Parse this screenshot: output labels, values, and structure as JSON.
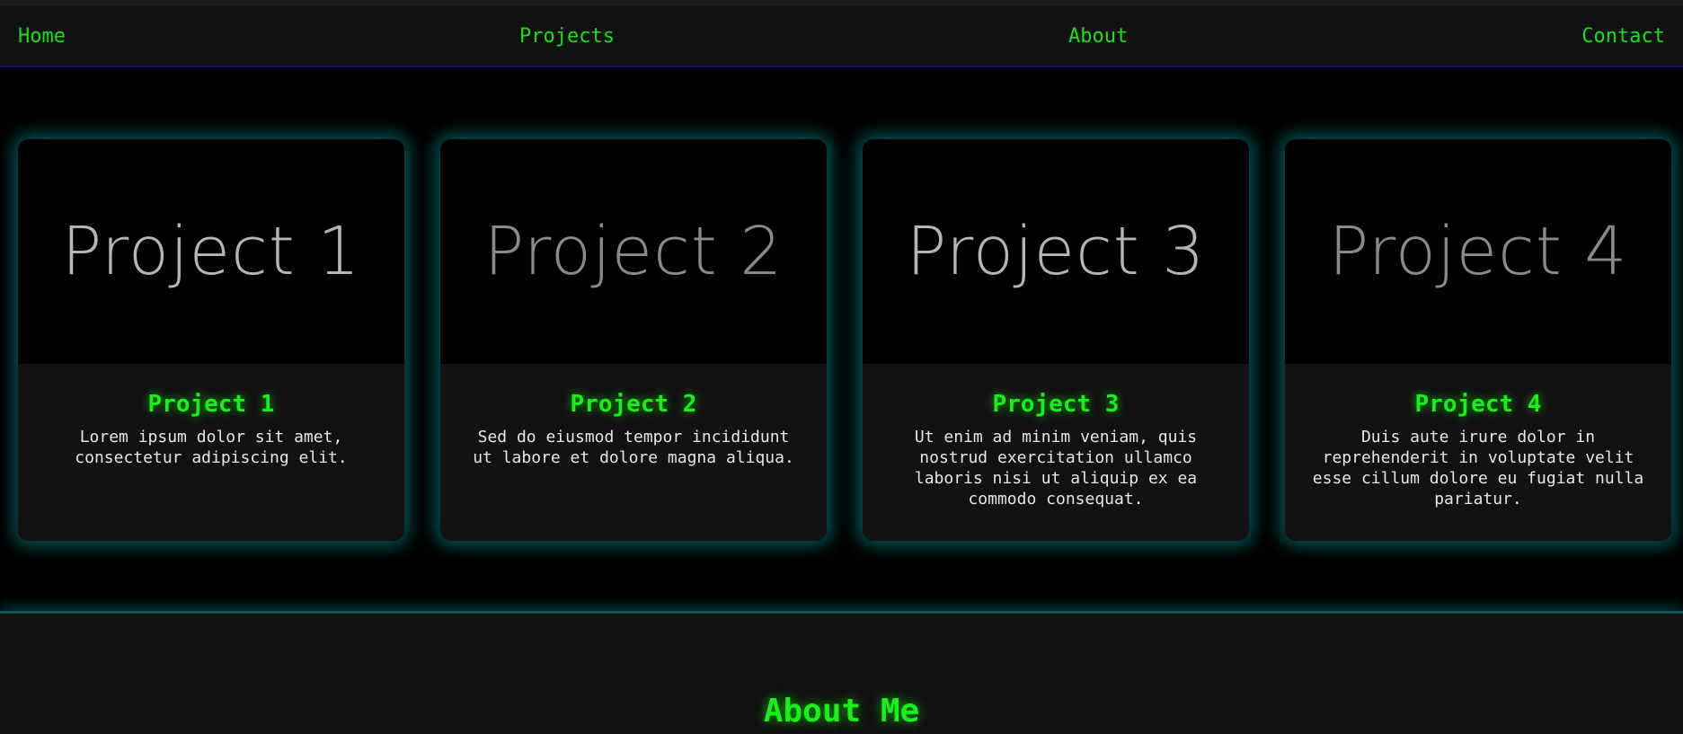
{
  "nav": {
    "items": [
      {
        "label": "Home"
      },
      {
        "label": "Projects"
      },
      {
        "label": "About"
      },
      {
        "label": "Contact"
      }
    ]
  },
  "projects": [
    {
      "image_text": "Project 1",
      "image_text_color": "#b5b5b5",
      "title": "Project 1",
      "description": "Lorem ipsum dolor sit amet, consectetur adipiscing elit."
    },
    {
      "image_text": "Project 2",
      "image_text_color": "#8a8a8a",
      "title": "Project 2",
      "description": "Sed do eiusmod tempor incididunt ut labore et dolore magna aliqua."
    },
    {
      "image_text": "Project 3",
      "image_text_color": "#b5b5b5",
      "title": "Project 3",
      "description": "Ut enim ad minim veniam, quis nostrud exercitation ullamco laboris nisi ut aliquip ex ea commodo consequat."
    },
    {
      "image_text": "Project 4",
      "image_text_color": "#8a8a8a",
      "title": "Project 4",
      "description": "Duis aute irure dolor in reprehenderit in voluptate velit esse cillum dolore eu fugiat nulla pariatur."
    }
  ],
  "about": {
    "title": "About Me"
  },
  "colors": {
    "accent": "#18f018",
    "glow": "#009696",
    "nav_border": "#0a0a8a",
    "background": "#000000",
    "surface": "#121212"
  }
}
